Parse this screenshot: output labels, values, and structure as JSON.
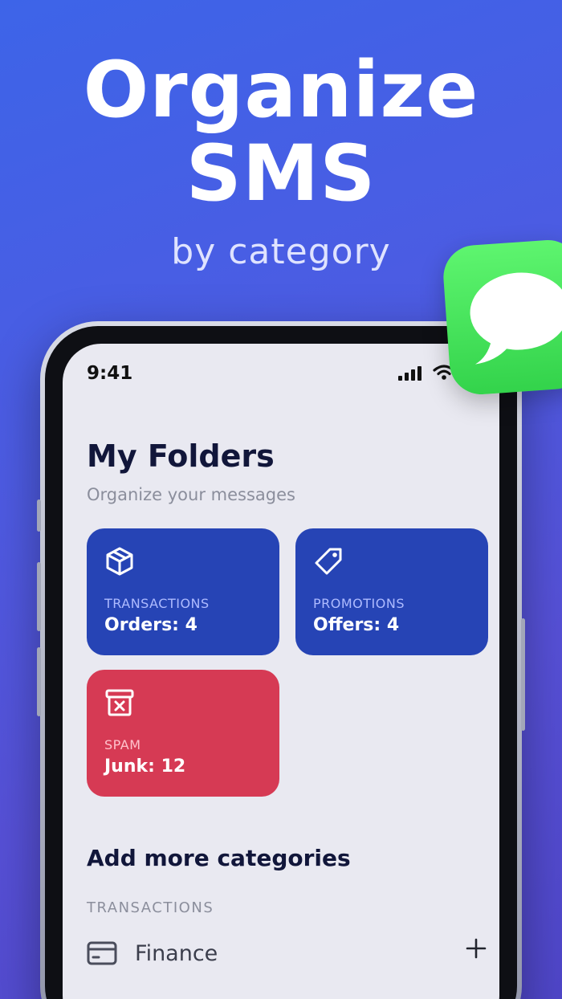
{
  "hero": {
    "title_line1": "Organize",
    "title_line2": "SMS",
    "subtitle": "by category"
  },
  "status_bar": {
    "time": "9:41"
  },
  "screen": {
    "title": "My Folders",
    "subtitle": "Organize your messages",
    "folders": [
      {
        "category": "TRANSACTIONS",
        "count_text": "Orders: 4",
        "icon": "package-icon",
        "color": "#2644b5"
      },
      {
        "category": "PROMOTIONS",
        "count_text": "Offers: 4",
        "icon": "tag-icon",
        "color": "#2644b5"
      },
      {
        "category": "SPAM",
        "count_text": "Junk: 12",
        "icon": "spam-bin-icon",
        "color": "#d63a54"
      }
    ],
    "add_section": {
      "title": "Add more categories",
      "group_label": "TRANSACTIONS",
      "items": [
        {
          "label": "Finance",
          "icon": "card-icon"
        }
      ]
    }
  },
  "colors": {
    "background_start": "#3d64e8",
    "background_end": "#5650d6",
    "folder_blue": "#2644b5",
    "folder_red": "#d63a54",
    "messages_green": "#34d34b"
  }
}
